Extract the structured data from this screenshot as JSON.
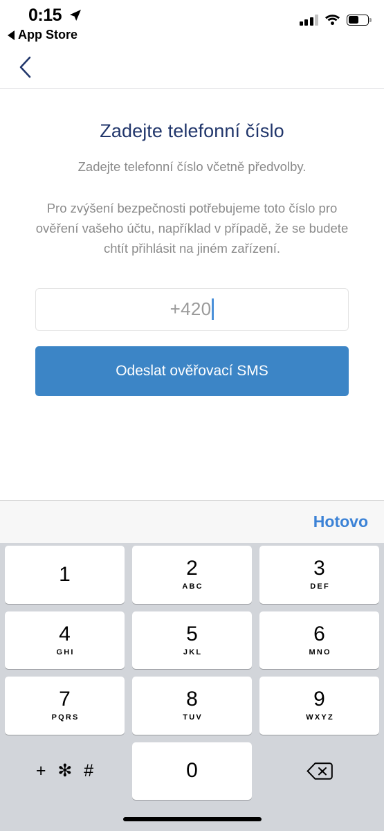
{
  "status_bar": {
    "time": "0:15",
    "location_icon": "location-arrow-icon",
    "return_app_label": "App Store",
    "signal_icon": "cellular-signal-icon",
    "wifi_icon": "wifi-icon",
    "battery_icon": "battery-icon",
    "battery_level_percent": 48
  },
  "nav": {
    "back_icon": "chevron-left-icon"
  },
  "screen": {
    "title": "Zadejte telefonní číslo",
    "subtitle": "Zadejte telefonní číslo včetně předvolby.",
    "description": "Pro zvýšení bezpečnosti potřebujeme toto číslo pro ověření vašeho účtu, například v případě, že se budete chtít přihlásit na jiném zařízení."
  },
  "phone_field": {
    "value": "+420",
    "placeholder": "+420",
    "caret_color": "#4a90d9"
  },
  "submit_button": {
    "label": "Odeslat ověřovací SMS",
    "color": "#3c85c6",
    "text_color": "#ffffff"
  },
  "keyboard": {
    "accessory": {
      "done_label": "Hotovo",
      "done_color": "#3b82d6"
    },
    "rows": [
      [
        {
          "digit": "1",
          "letters": ""
        },
        {
          "digit": "2",
          "letters": "ABC"
        },
        {
          "digit": "3",
          "letters": "DEF"
        }
      ],
      [
        {
          "digit": "4",
          "letters": "GHI"
        },
        {
          "digit": "5",
          "letters": "JKL"
        },
        {
          "digit": "6",
          "letters": "MNO"
        }
      ],
      [
        {
          "digit": "7",
          "letters": "PQRS"
        },
        {
          "digit": "8",
          "letters": "TUV"
        },
        {
          "digit": "9",
          "letters": "WXYZ"
        }
      ]
    ],
    "last_row": {
      "symbols": "+ ✻ #",
      "zero": "0",
      "backspace_icon": "backspace-delete-icon"
    },
    "background_color": "#d2d5da",
    "key_color": "#ffffff"
  },
  "home_indicator": "home-indicator-bar",
  "theme": {
    "title_color": "#21366b",
    "body_text_color": "#8a8a8a"
  }
}
